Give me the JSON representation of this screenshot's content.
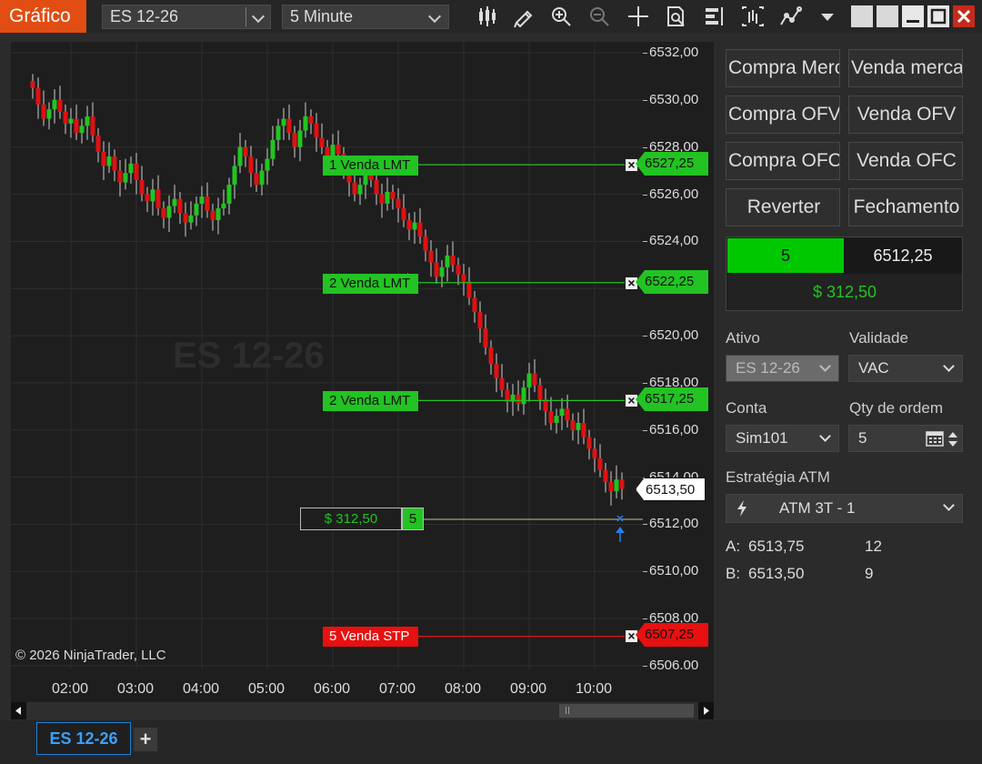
{
  "app": {
    "title": "Gráfico"
  },
  "toolbar": {
    "instrument": "ES 12-26",
    "interval": "5 Minute",
    "icons": [
      "bar-type-icon",
      "pencil-icon",
      "zoom-in-icon",
      "zoom-out-icon",
      "crosshair-icon",
      "data-box-icon",
      "chart-trader-icon",
      "indicators-icon",
      "strategies-icon",
      "more-menu-icon"
    ]
  },
  "window_controls": [
    "restore-icon",
    "restore-icon",
    "minimize-icon",
    "maximize-icon",
    "close-icon"
  ],
  "chart": {
    "watermark": "ES 12-26",
    "copyright": "© 2026 NinjaTrader, LLC",
    "y_ticks": [
      "6532,00",
      "6530,00",
      "6528,00",
      "6526,00",
      "6524,00",
      "6522,00",
      "6520,00",
      "6518,00",
      "6516,00",
      "6514,00",
      "6512,00",
      "6510,00",
      "6508,00",
      "6506,00"
    ],
    "x_ticks": [
      "02:00",
      "03:00",
      "04:00",
      "05:00",
      "06:00",
      "07:00",
      "08:00",
      "09:00",
      "10:00"
    ],
    "last_price": "6513,50",
    "position": {
      "pnl": "$ 312,50",
      "qty": "5"
    },
    "orders": [
      {
        "label": "1 Venda LMT",
        "price": "6527,25",
        "kind": "limit"
      },
      {
        "label": "2 Venda LMT",
        "price": "6522,25",
        "kind": "limit"
      },
      {
        "label": "2 Venda LMT",
        "price": "6517,25",
        "kind": "limit"
      },
      {
        "label": "5 Venda STP",
        "price": "6507,25",
        "kind": "stop"
      }
    ],
    "colors": {
      "up": "#21c521",
      "down": "#e01111",
      "limit": "#22c322",
      "stop": "#e81010",
      "background": "#1e1e1e"
    }
  },
  "chart_data": {
    "type": "candlestick",
    "symbol": "ES 12-26",
    "ylim": [
      6506,
      6532
    ],
    "x": [
      "01:25",
      "01:30",
      "01:35",
      "01:40",
      "01:45",
      "01:50",
      "01:55",
      "02:00",
      "02:05",
      "02:10",
      "02:15",
      "02:20",
      "02:25",
      "02:30",
      "02:35",
      "02:40",
      "02:45",
      "02:50",
      "02:55",
      "03:00",
      "03:05",
      "03:10",
      "03:15",
      "03:20",
      "03:25",
      "03:30",
      "03:35",
      "03:40",
      "03:45",
      "03:50",
      "03:55",
      "04:00",
      "04:05",
      "04:10",
      "04:15",
      "04:20",
      "04:25",
      "04:30",
      "04:35",
      "04:40",
      "04:45",
      "04:50",
      "04:55",
      "05:00",
      "05:05",
      "05:10",
      "05:15",
      "05:20",
      "05:25",
      "05:30",
      "05:35",
      "05:40",
      "05:45",
      "05:50",
      "05:55",
      "06:00",
      "06:05",
      "06:10",
      "06:15",
      "06:20",
      "06:25",
      "06:30",
      "06:35",
      "06:40",
      "06:45",
      "06:50",
      "06:55",
      "07:00",
      "07:05",
      "07:10",
      "07:15",
      "07:20",
      "07:25",
      "07:30",
      "07:35",
      "07:40",
      "07:45",
      "07:50",
      "07:55",
      "08:00",
      "08:05",
      "08:10",
      "08:15",
      "08:20",
      "08:25",
      "08:30",
      "08:35",
      "08:40",
      "08:45",
      "08:50",
      "08:55",
      "09:00",
      "09:05",
      "09:10",
      "09:15",
      "09:20",
      "09:25",
      "09:30",
      "09:35",
      "09:40",
      "09:45",
      "09:50",
      "09:55",
      "10:00",
      "10:05",
      "10:10",
      "10:15",
      "10:20",
      "10:25"
    ],
    "close": [
      6530.5,
      6529.8,
      6529.2,
      6529.6,
      6530.0,
      6529.5,
      6529.0,
      6529.2,
      6528.6,
      6528.9,
      6529.3,
      6528.5,
      6527.8,
      6527.2,
      6527.6,
      6527.0,
      6526.5,
      6526.9,
      6527.3,
      6526.6,
      6526.0,
      6525.7,
      6526.2,
      6525.4,
      6525.0,
      6525.5,
      6525.8,
      6525.2,
      6524.8,
      6525.1,
      6525.6,
      6525.9,
      6525.3,
      6524.9,
      6525.4,
      6525.6,
      6526.4,
      6527.2,
      6528.0,
      6527.6,
      6526.9,
      6526.4,
      6527.0,
      6527.5,
      6528.3,
      6528.9,
      6529.2,
      6528.6,
      6528.0,
      6528.7,
      6529.3,
      6529.0,
      6528.4,
      6528.0,
      6527.6,
      6528.1,
      6527.7,
      6527.1,
      6526.5,
      6526.0,
      6526.4,
      6526.9,
      6526.6,
      6526.0,
      6525.6,
      6526.1,
      6525.8,
      6525.4,
      6524.9,
      6524.5,
      6524.8,
      6524.2,
      6523.6,
      6523.1,
      6522.5,
      6522.9,
      6523.4,
      6523.0,
      6522.6,
      6522.3,
      6521.6,
      6521.0,
      6520.3,
      6519.5,
      6518.8,
      6518.2,
      6517.7,
      6517.2,
      6517.5,
      6517.1,
      6517.8,
      6518.4,
      6517.9,
      6517.3,
      6516.8,
      6516.3,
      6516.6,
      6516.9,
      6516.4,
      6516.0,
      6516.3,
      6515.7,
      6515.2,
      6514.8,
      6514.3,
      6513.8,
      6513.4,
      6513.9,
      6513.5
    ]
  },
  "panel": {
    "buttons": {
      "buy_market": "Compra Mercado",
      "sell_market": "Venda mercado",
      "buy_ofv": "Compra OFV",
      "sell_ofv": "Venda OFV",
      "buy_ofc": "Compra OFC",
      "sell_ofc": "Venda OFC",
      "reverse": "Reverter",
      "close": "Fechamento"
    },
    "position": {
      "qty": "5",
      "avg_price": "6512,25",
      "pnl": "$ 312,50"
    },
    "ativo_label": "Ativo",
    "ativo_value": "ES 12-26",
    "validade_label": "Validade",
    "validade_value": "VAC",
    "conta_label": "Conta",
    "conta_value": "Sim101",
    "qty_label": "Qty de ordem",
    "qty_value": "5",
    "atm_label": "Estratégia ATM",
    "atm_value": "ATM 3T - 1",
    "ask_label": "A:",
    "ask_price": "6513,75",
    "ask_size": "12",
    "bid_label": "B:",
    "bid_price": "6513,50",
    "bid_size": "9"
  },
  "tabs": [
    {
      "label": "ES 12-26",
      "active": true
    }
  ],
  "tab_add_label": "+"
}
